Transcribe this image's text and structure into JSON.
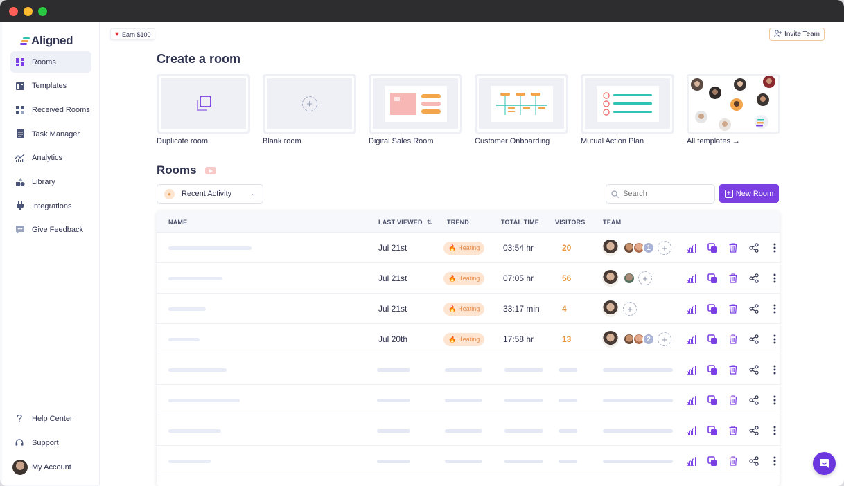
{
  "brand": {
    "name": "Aligned"
  },
  "sidebar": {
    "items": [
      {
        "label": "Rooms",
        "icon": "rooms-icon",
        "active": true
      },
      {
        "label": "Templates",
        "icon": "templates-icon"
      },
      {
        "label": "Received Rooms",
        "icon": "received-rooms-icon"
      },
      {
        "label": "Task Manager",
        "icon": "task-manager-icon"
      },
      {
        "label": "Analytics",
        "icon": "analytics-icon"
      },
      {
        "label": "Library",
        "icon": "library-icon"
      },
      {
        "label": "Integrations",
        "icon": "plug-icon"
      },
      {
        "label": "Give Feedback",
        "icon": "feedback-icon"
      }
    ],
    "bottom": [
      {
        "label": "Help Center",
        "icon": "question-icon"
      },
      {
        "label": "Support",
        "icon": "headset-icon"
      },
      {
        "label": "My Account",
        "icon": "avatar"
      }
    ]
  },
  "header": {
    "earn_label": "Earn $100",
    "invite_label": "Invite Team"
  },
  "create": {
    "title": "Create a room",
    "cards": [
      {
        "label": "Duplicate room"
      },
      {
        "label": "Blank room"
      },
      {
        "label": "Digital Sales Room"
      },
      {
        "label": "Customer Onboarding"
      },
      {
        "label": "Mutual Action Plan"
      },
      {
        "label": "All templates →"
      }
    ]
  },
  "rooms": {
    "title": "Rooms",
    "filter_label": "Recent Activity",
    "search_placeholder": "Search",
    "new_room_label": "New Room",
    "columns": [
      "NAME",
      "LAST VIEWED",
      "TREND",
      "TOTAL TIME",
      "VISITORS",
      "TEAM"
    ],
    "rows": [
      {
        "last_viewed": "Jul 21st",
        "trend": "Heating",
        "total_time": "03:54 hr",
        "visitors": "20",
        "extra": "1"
      },
      {
        "last_viewed": "Jul 21st",
        "trend": "Heating",
        "total_time": "07:05 hr",
        "visitors": "56",
        "extra": ""
      },
      {
        "last_viewed": "Jul 21st",
        "trend": "Heating",
        "total_time": "33:17 min",
        "visitors": "4",
        "extra": ""
      },
      {
        "last_viewed": "Jul 20th",
        "trend": "Heating",
        "total_time": "17:58 hr",
        "visitors": "13",
        "extra": "2"
      }
    ]
  },
  "colors": {
    "accent": "#7b3fe4",
    "heating_bg": "#fde5d2",
    "heating_text": "#e2894a",
    "visitors": "#e8973f"
  }
}
